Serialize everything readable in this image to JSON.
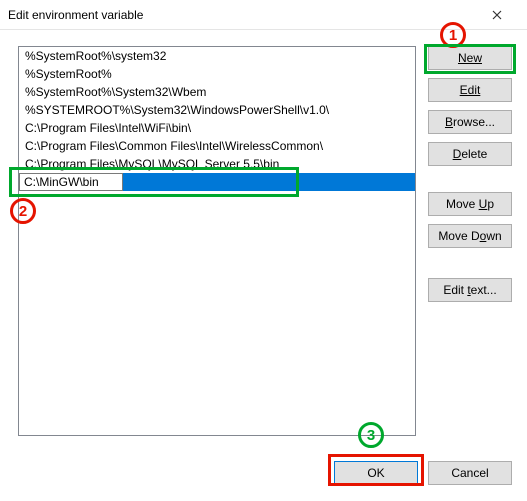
{
  "window": {
    "title": "Edit environment variable"
  },
  "list": {
    "items": [
      "%SystemRoot%\\system32",
      "%SystemRoot%",
      "%SystemRoot%\\System32\\Wbem",
      "%SYSTEMROOT%\\System32\\WindowsPowerShell\\v1.0\\",
      "C:\\Program Files\\Intel\\WiFi\\bin\\",
      "C:\\Program Files\\Common Files\\Intel\\WirelessCommon\\",
      "C:\\Program Files\\MySQL\\MySQL Server 5.5\\bin"
    ],
    "editing_value": "C:\\MinGW\\bin",
    "editing_index": 7
  },
  "buttons": {
    "new": "New",
    "edit": "Edit",
    "browse": "Browse...",
    "delete": "Delete",
    "move_up": "Move Up",
    "move_down": "Move Down",
    "edit_text": "Edit text...",
    "ok": "OK",
    "cancel": "Cancel"
  },
  "annotations": {
    "label1": "1",
    "label2": "2",
    "label3": "3"
  }
}
